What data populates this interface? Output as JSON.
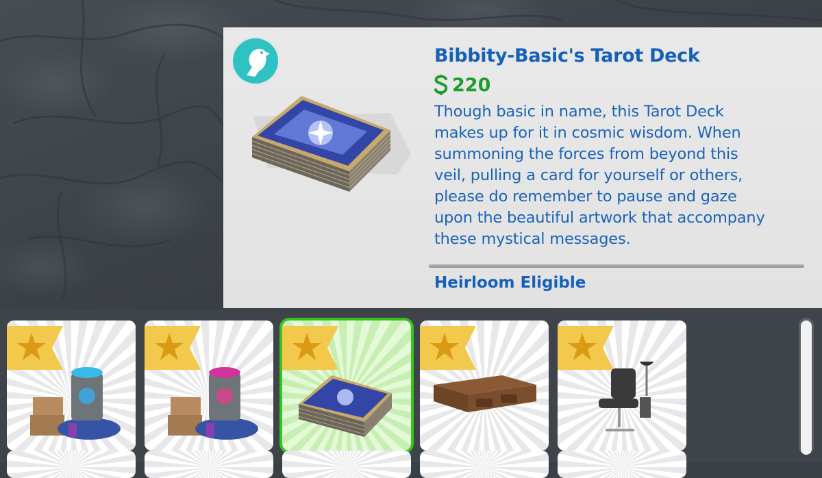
{
  "tooltip": {
    "title": "Bibbity-Basic's Tarot Deck",
    "price": "220",
    "price_icon": "simoleon-icon",
    "pack_icon": "raven-pack-icon",
    "description_lines": [
      "Though basic in name, this Tarot Deck",
      "makes up for it in cosmic wisdom. When",
      "summoning the forces from beyond this",
      "veil, pulling a card for yourself or others,",
      "please do remember to pause and gaze",
      "upon the beautiful artwork that accompany",
      "these mystical messages."
    ],
    "trait": "Heirloom Eligible"
  },
  "catalog": {
    "items": [
      {
        "name": "teal-cauldron-station",
        "favorite_icon": "star-icon",
        "selected": false
      },
      {
        "name": "pink-cauldron-station",
        "favorite_icon": "star-icon",
        "selected": false
      },
      {
        "name": "tarot-deck",
        "favorite_icon": "star-icon",
        "selected": true
      },
      {
        "name": "wooden-coffee-table",
        "favorite_icon": "star-icon",
        "selected": false
      },
      {
        "name": "tattoo-chair",
        "favorite_icon": "star-icon",
        "selected": false
      }
    ]
  },
  "colors": {
    "title_blue": "#1660b8",
    "price_green": "#1f9c2d",
    "selection_green": "#37c21f",
    "badge_teal": "#2ec2c4",
    "ribbon_gold": "#f2c94c"
  }
}
